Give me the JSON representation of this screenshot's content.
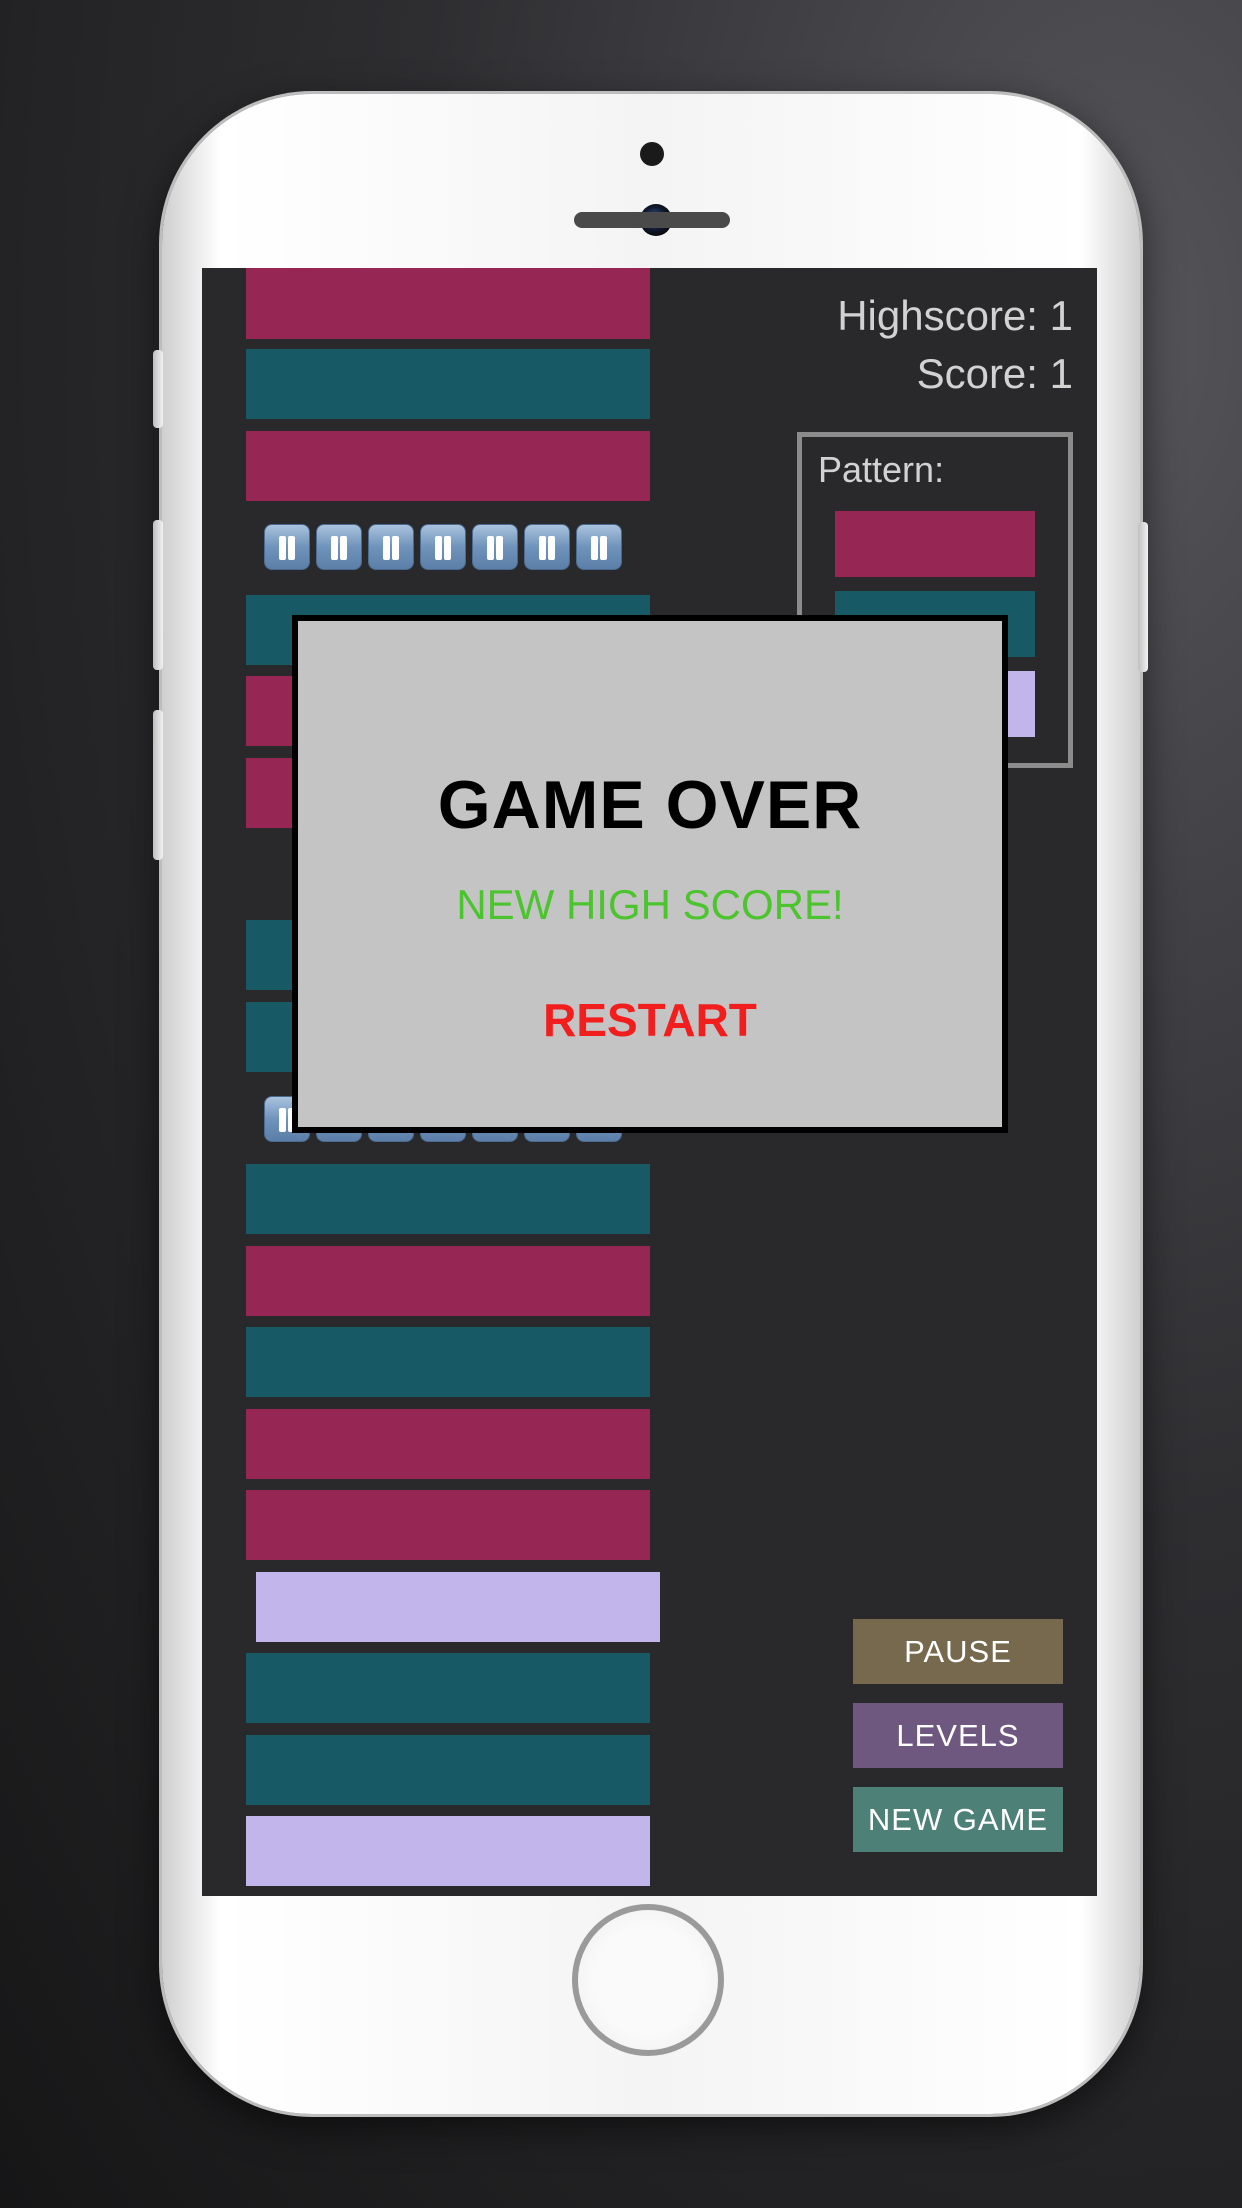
{
  "hud": {
    "highscore_label": "Highscore: 1",
    "score_label": "Score: 1"
  },
  "pattern": {
    "title": "Pattern:",
    "colors": [
      "magenta",
      "teal",
      "lavender"
    ]
  },
  "buttons": {
    "pause": "PAUSE",
    "levels": "LEVELS",
    "new_game": "NEW GAME"
  },
  "dialog": {
    "title": "GAME OVER",
    "subtitle": "NEW HIGH SCORE!",
    "restart": "RESTART"
  },
  "colors": {
    "magenta": "#962654",
    "teal": "#185966",
    "lavender": "#c2b5eb",
    "pause_button": "#76694e",
    "levels_button": "#6f5880",
    "new_game_button": "#4d8077",
    "high_score_text": "#4cc42e",
    "restart_text": "#f21d1d"
  },
  "stack": {
    "pause_icon_count": 7
  }
}
